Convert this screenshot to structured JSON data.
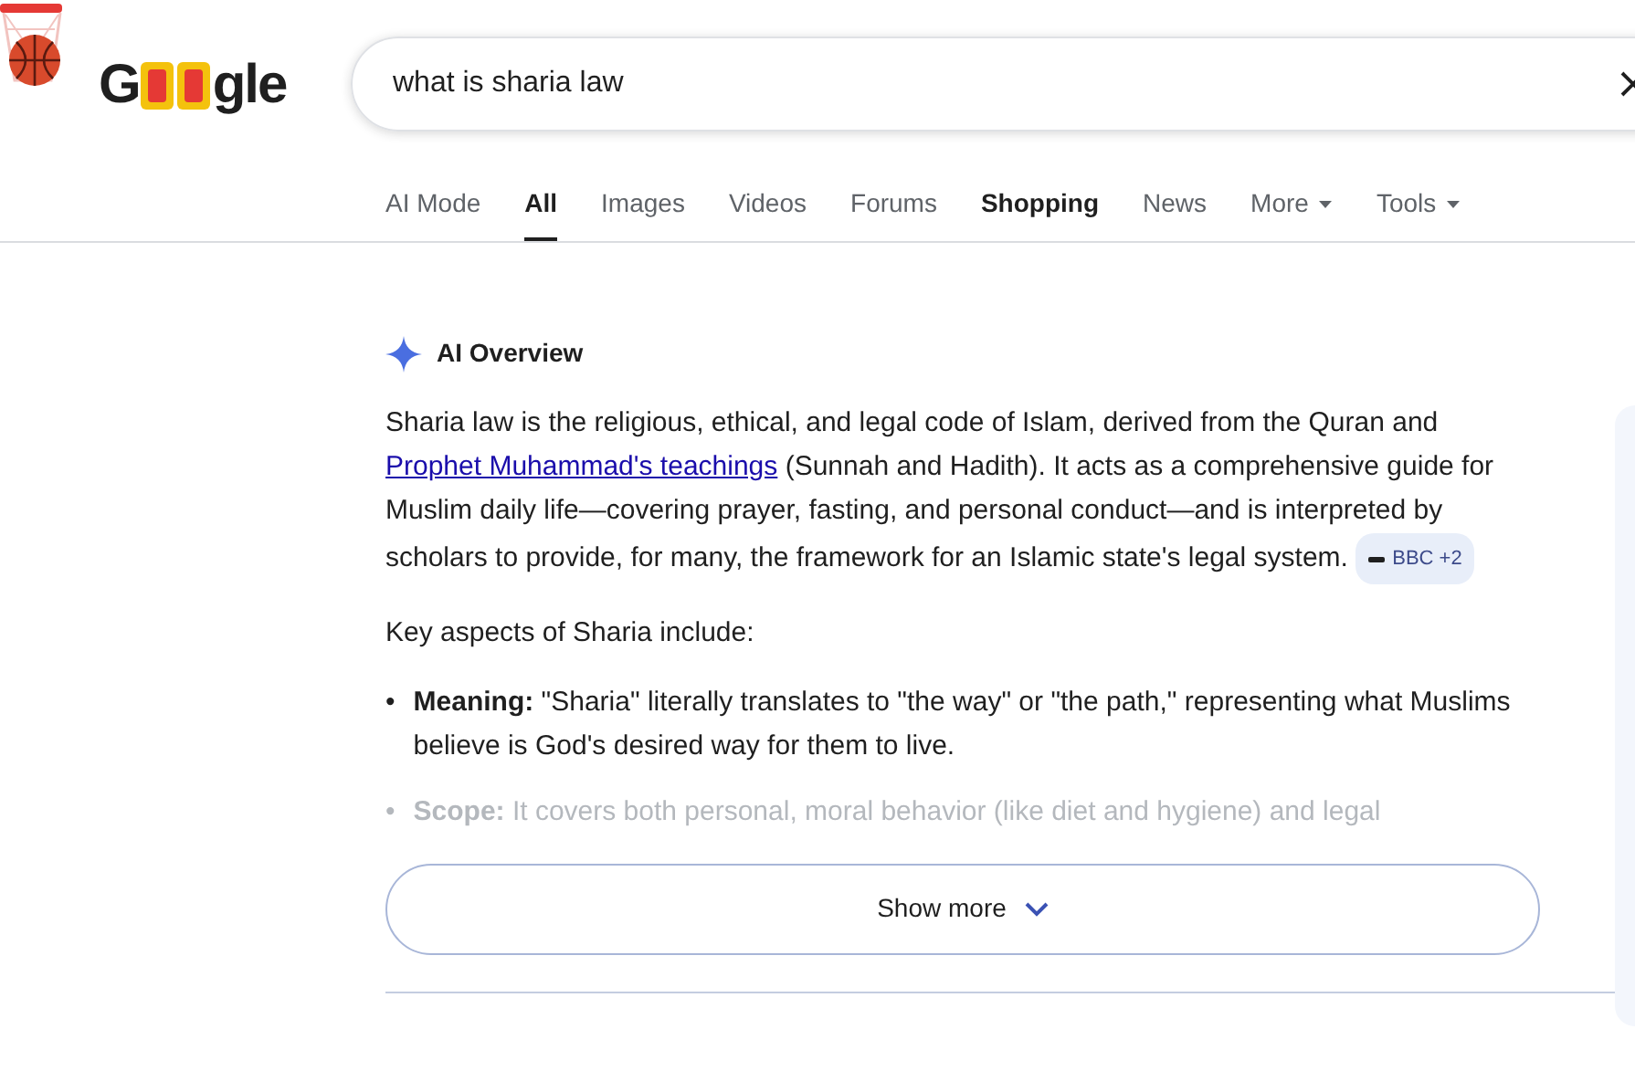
{
  "logo": {
    "start": "G",
    "end": "gle"
  },
  "search": {
    "value": "what is sharia law"
  },
  "tabs": [
    {
      "label": "AI Mode",
      "selected": false,
      "emphasized": false,
      "dropdown": false
    },
    {
      "label": "All",
      "selected": true,
      "emphasized": false,
      "dropdown": false
    },
    {
      "label": "Images",
      "selected": false,
      "emphasized": false,
      "dropdown": false
    },
    {
      "label": "Videos",
      "selected": false,
      "emphasized": false,
      "dropdown": false
    },
    {
      "label": "Forums",
      "selected": false,
      "emphasized": false,
      "dropdown": false
    },
    {
      "label": "Shopping",
      "selected": false,
      "emphasized": true,
      "dropdown": false
    },
    {
      "label": "News",
      "selected": false,
      "emphasized": false,
      "dropdown": false
    },
    {
      "label": "More",
      "selected": false,
      "emphasized": false,
      "dropdown": true
    },
    {
      "label": "Tools",
      "selected": false,
      "emphasized": false,
      "dropdown": true
    }
  ],
  "overview": {
    "title": "AI Overview",
    "paragraph": {
      "text_before": "Sharia law is the religious, ethical, and legal code of Islam, derived from the Quran and",
      "link": "Prophet Muhammad's teachings",
      "text_after": "(Sunnah and Hadith). It acts as a comprehensive guide for Muslim daily life—covering prayer, fasting, and personal conduct—and is interpreted by scholars to provide, for many, the framework for an Islamic state's legal system.",
      "sources": "BBC +2"
    },
    "intro": "Key aspects of Sharia include:",
    "bullets": [
      {
        "marker": "•",
        "term": "Meaning:",
        "text": "\"Sharia\" literally translates to \"the way\" or \"the path,\" representing what Muslims believe is God's desired way for them to live.",
        "faded": false
      },
      {
        "marker": "•",
        "term": "Scope:",
        "text": "It covers both personal, moral behavior (like diet and hygiene) and legal",
        "faded": true
      }
    ],
    "show_more": "Show more"
  }
}
